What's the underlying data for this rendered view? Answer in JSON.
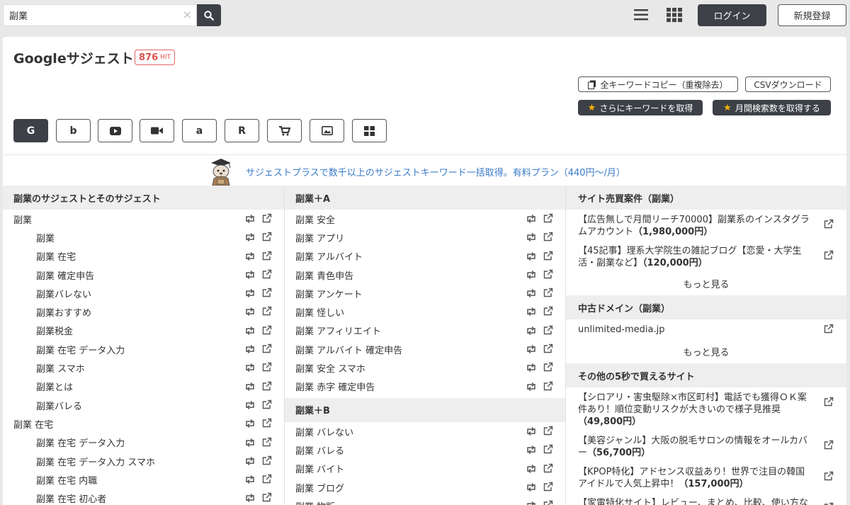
{
  "search": {
    "value": "副業",
    "clear": "×"
  },
  "header": {
    "login_label": "ログイン",
    "register_label": "新規登録"
  },
  "page": {
    "title": "Googleサジェスト",
    "hit_count": "876",
    "hit_unit": "HIT"
  },
  "actions": {
    "copy_all": "全キーワードコピー（重複除去）",
    "csv": "CSVダウンロード",
    "more_keywords": "さらにキーワードを取得",
    "monthly": "月間検索数を取得する"
  },
  "engines": [
    {
      "name": "google",
      "glyph": "G"
    },
    {
      "name": "bing",
      "glyph": "b"
    },
    {
      "name": "youtube",
      "glyph": "▶"
    },
    {
      "name": "video",
      "glyph": "■"
    },
    {
      "name": "amazon",
      "glyph": "a"
    },
    {
      "name": "rakuten",
      "glyph": "R"
    },
    {
      "name": "shopping",
      "glyph": "🛒"
    },
    {
      "name": "image",
      "glyph": "▣"
    },
    {
      "name": "all",
      "glyph": "▦"
    }
  ],
  "promo": {
    "text": "サジェストプラスで数千以上のサジェストキーワード一括取得。有料プラン（440円〜/月）"
  },
  "col1": {
    "heading": "副業のサジェストとそのサジェスト",
    "rows": [
      {
        "text": "副業",
        "child": false
      },
      {
        "text": "副業",
        "child": true
      },
      {
        "text": "副業 在宅",
        "child": true
      },
      {
        "text": "副業 確定申告",
        "child": true
      },
      {
        "text": "副業バレない",
        "child": true
      },
      {
        "text": "副業おすすめ",
        "child": true
      },
      {
        "text": "副業税金",
        "child": true
      },
      {
        "text": "副業 在宅 データ入力",
        "child": true
      },
      {
        "text": "副業 スマホ",
        "child": true
      },
      {
        "text": "副業とは",
        "child": true
      },
      {
        "text": "副業バレる",
        "child": true
      },
      {
        "text": "副業 在宅",
        "child": false
      },
      {
        "text": "副業 在宅 データ入力",
        "child": true
      },
      {
        "text": "副業 在宅 データ入力 スマホ",
        "child": true
      },
      {
        "text": "副業 在宅 内職",
        "child": true
      },
      {
        "text": "副業 在宅 初心者",
        "child": true
      }
    ]
  },
  "col2": {
    "heading_a": "副業＋A",
    "rows_a": [
      "副業 安全",
      "副業 アプリ",
      "副業 アルバイト",
      "副業 青色申告",
      "副業 アンケート",
      "副業 怪しい",
      "副業 アフィリエイト",
      "副業 アルバイト 確定申告",
      "副業 安全 スマホ",
      "副業 赤字 確定申告"
    ],
    "heading_b": "副業＋B",
    "rows_b": [
      "副業 バレない",
      "副業 バレる",
      "副業 バイト",
      "副業 ブログ",
      "副業 物販"
    ]
  },
  "col3": {
    "sale_heading": "サイト売買案件（副業）",
    "sale_items": [
      {
        "text": "【広告無しで月間リーチ70000】副業系のインスタグラムアカウント",
        "price": "（1,980,000円）"
      },
      {
        "text": "【45記事】理系大学院生の雑記ブログ【恋愛・大学生活・副業など】",
        "price": "（120,000円）"
      }
    ],
    "more1": "もっと見る",
    "domain_heading": "中古ドメイン（副業）",
    "domain_item": "unlimited-media.jp",
    "more2": "もっと見る",
    "other_heading": "その他の5秒で買えるサイト",
    "other_items": [
      {
        "text": "【シロアリ・害虫駆除×市区町村】電話でも獲得ＯＫ案件あり！順位変動リスクが大きいので様子見推奨",
        "price": "（49,800円）"
      },
      {
        "text": "【美容ジャンル】大阪の脱毛サロンの情報をオールカバー",
        "price": "（56,700円）"
      },
      {
        "text": "【KPOP特化】アドセンス収益あり！世界で注目の韓国アイドルで人気上昇中！",
        "price": "（157,000円）"
      },
      {
        "text": "【家電特化サイト】レビュー、まとめ、比較、使い方など",
        "price": ""
      }
    ]
  }
}
